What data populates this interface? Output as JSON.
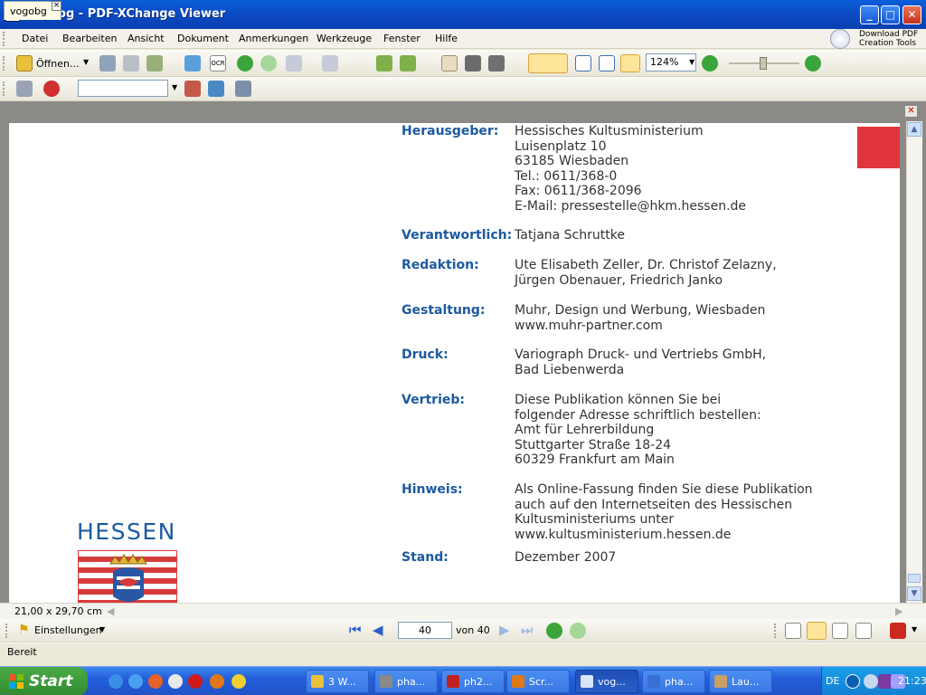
{
  "window": {
    "title": "vogobg - PDF-XChange Viewer",
    "min": "_",
    "max": "□",
    "close": "✕"
  },
  "menu": [
    "Datei",
    "Bearbeiten",
    "Ansicht",
    "Dokument",
    "Anmerkungen",
    "Werkzeuge",
    "Fenster",
    "Hilfe"
  ],
  "download_pdf": {
    "line1": "Download PDF",
    "line2": "Creation Tools"
  },
  "toolbar1": {
    "open_label": "Öffnen...",
    "zoom_value": "124%"
  },
  "toolbar2": {
    "search_value": ""
  },
  "tab": {
    "label": "vogobg",
    "close": "×"
  },
  "document": {
    "entries": [
      {
        "label": "Herausgeber:",
        "lines": [
          "Hessisches Kultusministerium",
          "Luisenplatz 10",
          "63185 Wiesbaden",
          "Tel.: 0611/368-0",
          "Fax: 0611/368-2096",
          "E-Mail: pressestelle@hkm.hessen.de"
        ]
      },
      {
        "label": "Verantwortlich:",
        "lines": [
          "Tatjana Schruttke"
        ]
      },
      {
        "label": "Redaktion:",
        "lines": [
          "Ute Elisabeth Zeller, Dr. Christof Zelazny,",
          "Jürgen Obenauer, Friedrich Janko"
        ]
      },
      {
        "label": "Gestaltung:",
        "lines": [
          "Muhr, Design und Werbung, Wiesbaden",
          "www.muhr-partner.com"
        ]
      },
      {
        "label": "Druck:",
        "lines": [
          "Variograph Druck- und Vertriebs GmbH,",
          "Bad Liebenwerda"
        ]
      },
      {
        "label": "Vertrieb:",
        "lines": [
          "Diese Publikation können Sie bei",
          "folgender Adresse schriftlich bestellen:",
          "Amt für Lehrerbildung",
          "Stuttgarter Straße 18-24",
          "60329 Frankfurt am Main"
        ]
      },
      {
        "label": "Hinweis:",
        "lines": [
          "Als Online-Fassung finden Sie diese Publikation",
          "auch auf den Internetseiten des Hessischen",
          "Kultusministeriums unter",
          "www.kultusministerium.hessen.de"
        ]
      },
      {
        "label": "Stand:",
        "lines": [
          "Dezember 2007"
        ]
      }
    ],
    "logo_text": "HESSEN"
  },
  "page_size": "21,00 x 29,70 cm",
  "navigation": {
    "settings_label": "Einstellungen",
    "current_page": "40",
    "of_label": "von 40"
  },
  "status": "Bereit",
  "taskbar": {
    "start": "Start",
    "tasks": [
      "3 W...",
      "pha...",
      "ph2...",
      "Scr...",
      "vog...",
      "pha...",
      "Lau..."
    ],
    "active_index": 4,
    "lang": "DE",
    "clock": "21:23"
  },
  "colors": {
    "label_blue": "#1d5aa0",
    "accent_red": "#e0353c",
    "xp_blue": "#245edb"
  }
}
